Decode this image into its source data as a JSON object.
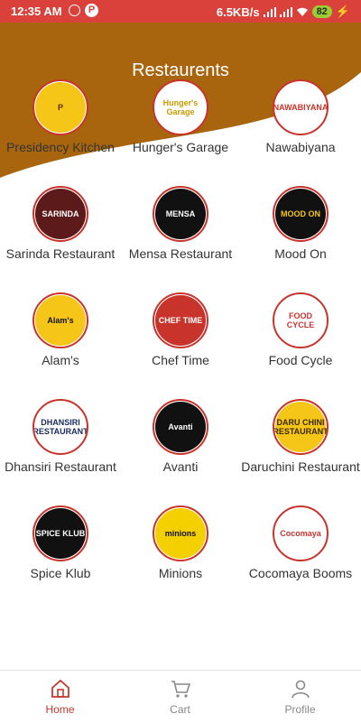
{
  "statusbar": {
    "time": "12:35 AM",
    "speed": "6.5KB/s",
    "battery": "82"
  },
  "header": {
    "title": "Restaurents"
  },
  "restaurants": [
    {
      "name": "Presidency Kitchen",
      "logo_text": "P",
      "logo_bg": "#f5c518",
      "logo_fg": "#5a2d00"
    },
    {
      "name": "Hunger's Garage",
      "logo_text": "Hunger's Garage",
      "logo_bg": "#ffffff",
      "logo_fg": "#c89b00"
    },
    {
      "name": "Nawabiyana",
      "logo_text": "NAWABIYANA",
      "logo_bg": "#ffffff",
      "logo_fg": "#c8342c"
    },
    {
      "name": "Sarinda Restaurant",
      "logo_text": "SARINDA",
      "logo_bg": "#5c1a1a",
      "logo_fg": "#ffffff"
    },
    {
      "name": "Mensa Restaurant",
      "logo_text": "MENSA",
      "logo_bg": "#111111",
      "logo_fg": "#ffffff"
    },
    {
      "name": "Mood On",
      "logo_text": "MOOD ON",
      "logo_bg": "#111111",
      "logo_fg": "#f5c518"
    },
    {
      "name": "Alam's",
      "logo_text": "Alam's",
      "logo_bg": "#f5c518",
      "logo_fg": "#111111"
    },
    {
      "name": "Chef Time",
      "logo_text": "CHEF TIME",
      "logo_bg": "#c8342c",
      "logo_fg": "#ffffff"
    },
    {
      "name": "Food Cycle",
      "logo_text": "FOOD CYCLE",
      "logo_bg": "#ffffff",
      "logo_fg": "#c8342c"
    },
    {
      "name": "Dhansiri Restaurant",
      "logo_text": "DHANSIRI RESTAURANT",
      "logo_bg": "#ffffff",
      "logo_fg": "#1a2b5c"
    },
    {
      "name": "Avanti",
      "logo_text": "Avanti",
      "logo_bg": "#111111",
      "logo_fg": "#ffffff"
    },
    {
      "name": "Daruchini Restaurant",
      "logo_text": "DARU CHINI RESTAURANT",
      "logo_bg": "#f5c518",
      "logo_fg": "#3a2a00"
    },
    {
      "name": "Spice Klub",
      "logo_text": "SPICE KLUB",
      "logo_bg": "#111111",
      "logo_fg": "#ffffff"
    },
    {
      "name": "Minions",
      "logo_text": "minions",
      "logo_bg": "#f5d000",
      "logo_fg": "#111111"
    },
    {
      "name": "Cocomaya Booms",
      "logo_text": "Cocomaya",
      "logo_bg": "#ffffff",
      "logo_fg": "#c8342c"
    }
  ],
  "bottom_nav": [
    {
      "label": "Home",
      "icon": "home-icon",
      "active": true
    },
    {
      "label": "Cart",
      "icon": "cart-icon",
      "active": false
    },
    {
      "label": "Profile",
      "icon": "profile-icon",
      "active": false
    }
  ],
  "colors": {
    "accent": "#c4382e",
    "header_brown": "#a8650e",
    "statusbar": "#d9413a"
  }
}
